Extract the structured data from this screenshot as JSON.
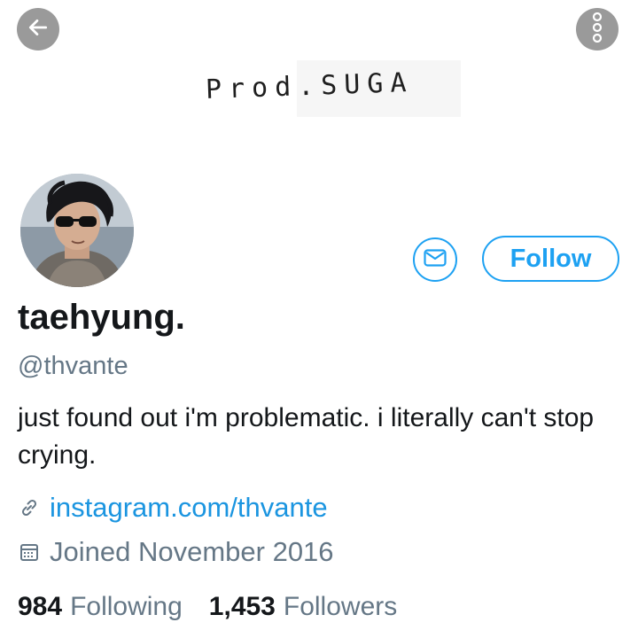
{
  "header": {
    "banner_text": "Prod.SUGA",
    "back_icon": "arrow-left-icon",
    "more_icon": "more-vertical-icon"
  },
  "profile": {
    "display_name": "taehyung.",
    "handle": "@thvante",
    "bio": "just found out i'm problematic. i literally can't stop crying.",
    "link": "instagram.com/thvante",
    "joined": "Joined November 2016"
  },
  "actions": {
    "follow_label": "Follow",
    "message_icon": "envelope-icon"
  },
  "stats": {
    "following_count": "984",
    "following_label": "Following",
    "followers_count": "1,453",
    "followers_label": "Followers"
  },
  "colors": {
    "accent": "#1da1f2",
    "secondary_text": "#657786",
    "overlay_button": "#9a9a9a"
  }
}
